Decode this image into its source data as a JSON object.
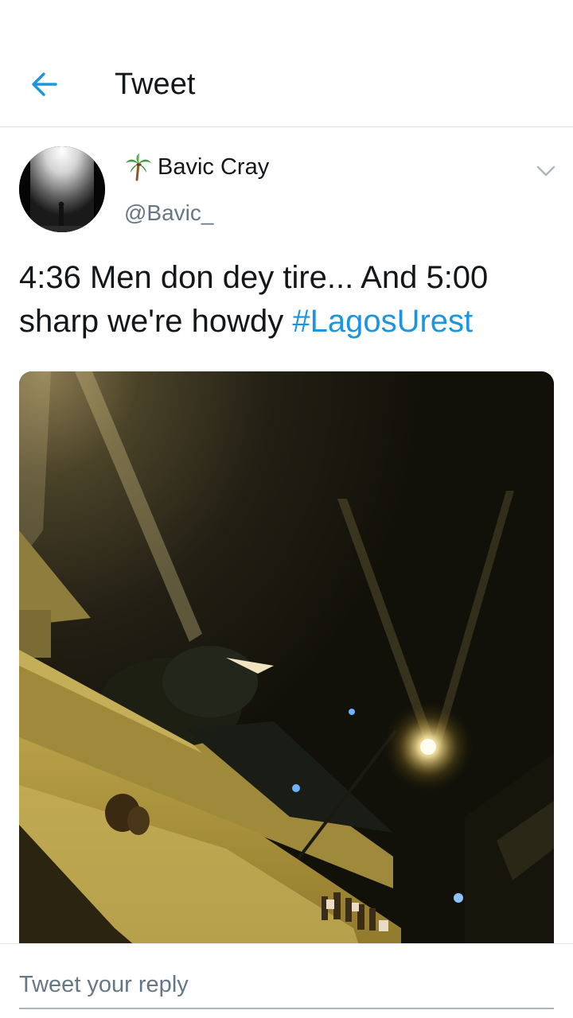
{
  "header": {
    "back_icon": "arrow-left-icon",
    "title": "Tweet"
  },
  "tweet": {
    "author": {
      "emoji_icon": "palm-tree-icon",
      "name": "Bavic Cray",
      "handle": "@Bavic_"
    },
    "more_icon": "chevron-down-icon",
    "text": "4:36 Men don dey tire... And 5:00 sharp we're howdy ",
    "hashtag": "#LagosUrest"
  },
  "reply": {
    "placeholder": "Tweet your reply"
  },
  "colors": {
    "accent": "#1b95e0",
    "text_primary": "#14171a",
    "text_secondary": "#657786",
    "divider": "#d8dde1"
  }
}
